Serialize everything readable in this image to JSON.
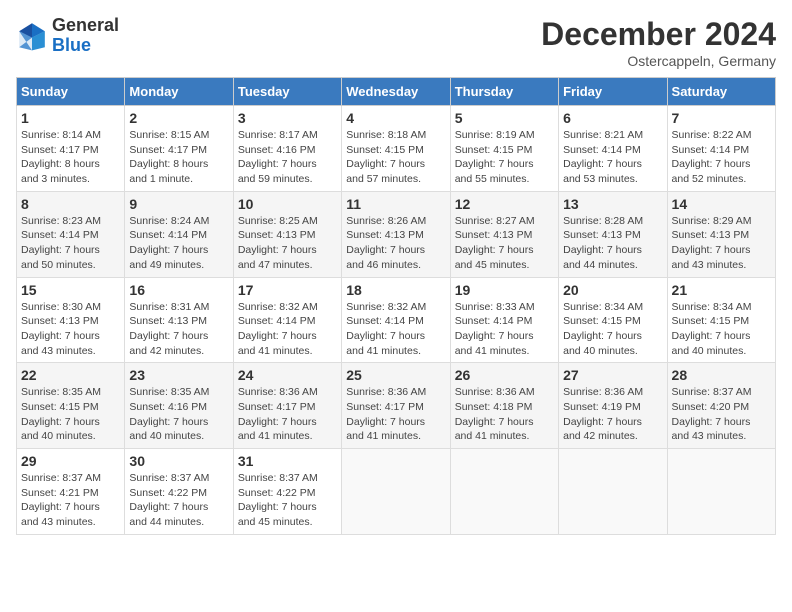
{
  "header": {
    "logo_general": "General",
    "logo_blue": "Blue",
    "month_title": "December 2024",
    "location": "Ostercappeln, Germany"
  },
  "weekdays": [
    "Sunday",
    "Monday",
    "Tuesday",
    "Wednesday",
    "Thursday",
    "Friday",
    "Saturday"
  ],
  "weeks": [
    [
      {
        "day": "1",
        "info": "Sunrise: 8:14 AM\nSunset: 4:17 PM\nDaylight: 8 hours\nand 3 minutes."
      },
      {
        "day": "2",
        "info": "Sunrise: 8:15 AM\nSunset: 4:17 PM\nDaylight: 8 hours\nand 1 minute."
      },
      {
        "day": "3",
        "info": "Sunrise: 8:17 AM\nSunset: 4:16 PM\nDaylight: 7 hours\nand 59 minutes."
      },
      {
        "day": "4",
        "info": "Sunrise: 8:18 AM\nSunset: 4:15 PM\nDaylight: 7 hours\nand 57 minutes."
      },
      {
        "day": "5",
        "info": "Sunrise: 8:19 AM\nSunset: 4:15 PM\nDaylight: 7 hours\nand 55 minutes."
      },
      {
        "day": "6",
        "info": "Sunrise: 8:21 AM\nSunset: 4:14 PM\nDaylight: 7 hours\nand 53 minutes."
      },
      {
        "day": "7",
        "info": "Sunrise: 8:22 AM\nSunset: 4:14 PM\nDaylight: 7 hours\nand 52 minutes."
      }
    ],
    [
      {
        "day": "8",
        "info": "Sunrise: 8:23 AM\nSunset: 4:14 PM\nDaylight: 7 hours\nand 50 minutes."
      },
      {
        "day": "9",
        "info": "Sunrise: 8:24 AM\nSunset: 4:14 PM\nDaylight: 7 hours\nand 49 minutes."
      },
      {
        "day": "10",
        "info": "Sunrise: 8:25 AM\nSunset: 4:13 PM\nDaylight: 7 hours\nand 47 minutes."
      },
      {
        "day": "11",
        "info": "Sunrise: 8:26 AM\nSunset: 4:13 PM\nDaylight: 7 hours\nand 46 minutes."
      },
      {
        "day": "12",
        "info": "Sunrise: 8:27 AM\nSunset: 4:13 PM\nDaylight: 7 hours\nand 45 minutes."
      },
      {
        "day": "13",
        "info": "Sunrise: 8:28 AM\nSunset: 4:13 PM\nDaylight: 7 hours\nand 44 minutes."
      },
      {
        "day": "14",
        "info": "Sunrise: 8:29 AM\nSunset: 4:13 PM\nDaylight: 7 hours\nand 43 minutes."
      }
    ],
    [
      {
        "day": "15",
        "info": "Sunrise: 8:30 AM\nSunset: 4:13 PM\nDaylight: 7 hours\nand 43 minutes."
      },
      {
        "day": "16",
        "info": "Sunrise: 8:31 AM\nSunset: 4:13 PM\nDaylight: 7 hours\nand 42 minutes."
      },
      {
        "day": "17",
        "info": "Sunrise: 8:32 AM\nSunset: 4:14 PM\nDaylight: 7 hours\nand 41 minutes."
      },
      {
        "day": "18",
        "info": "Sunrise: 8:32 AM\nSunset: 4:14 PM\nDaylight: 7 hours\nand 41 minutes."
      },
      {
        "day": "19",
        "info": "Sunrise: 8:33 AM\nSunset: 4:14 PM\nDaylight: 7 hours\nand 41 minutes."
      },
      {
        "day": "20",
        "info": "Sunrise: 8:34 AM\nSunset: 4:15 PM\nDaylight: 7 hours\nand 40 minutes."
      },
      {
        "day": "21",
        "info": "Sunrise: 8:34 AM\nSunset: 4:15 PM\nDaylight: 7 hours\nand 40 minutes."
      }
    ],
    [
      {
        "day": "22",
        "info": "Sunrise: 8:35 AM\nSunset: 4:15 PM\nDaylight: 7 hours\nand 40 minutes."
      },
      {
        "day": "23",
        "info": "Sunrise: 8:35 AM\nSunset: 4:16 PM\nDaylight: 7 hours\nand 40 minutes."
      },
      {
        "day": "24",
        "info": "Sunrise: 8:36 AM\nSunset: 4:17 PM\nDaylight: 7 hours\nand 41 minutes."
      },
      {
        "day": "25",
        "info": "Sunrise: 8:36 AM\nSunset: 4:17 PM\nDaylight: 7 hours\nand 41 minutes."
      },
      {
        "day": "26",
        "info": "Sunrise: 8:36 AM\nSunset: 4:18 PM\nDaylight: 7 hours\nand 41 minutes."
      },
      {
        "day": "27",
        "info": "Sunrise: 8:36 AM\nSunset: 4:19 PM\nDaylight: 7 hours\nand 42 minutes."
      },
      {
        "day": "28",
        "info": "Sunrise: 8:37 AM\nSunset: 4:20 PM\nDaylight: 7 hours\nand 43 minutes."
      }
    ],
    [
      {
        "day": "29",
        "info": "Sunrise: 8:37 AM\nSunset: 4:21 PM\nDaylight: 7 hours\nand 43 minutes."
      },
      {
        "day": "30",
        "info": "Sunrise: 8:37 AM\nSunset: 4:22 PM\nDaylight: 7 hours\nand 44 minutes."
      },
      {
        "day": "31",
        "info": "Sunrise: 8:37 AM\nSunset: 4:22 PM\nDaylight: 7 hours\nand 45 minutes."
      },
      null,
      null,
      null,
      null
    ]
  ]
}
